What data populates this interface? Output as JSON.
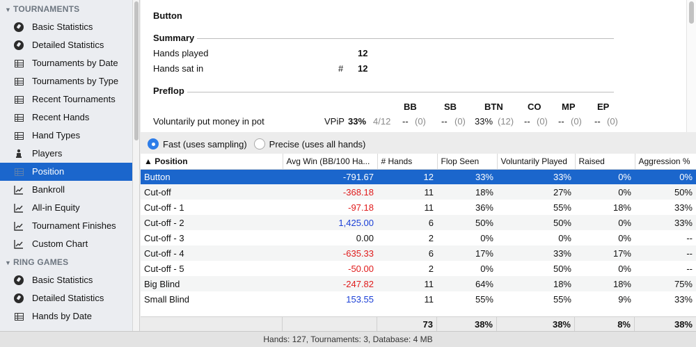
{
  "sidebar": {
    "sections": [
      {
        "title": "TOURNAMENTS",
        "items": [
          {
            "label": "Basic Statistics",
            "icon": "dashboard-icon"
          },
          {
            "label": "Detailed Statistics",
            "icon": "dashboard-icon"
          },
          {
            "label": "Tournaments by Date",
            "icon": "table-icon"
          },
          {
            "label": "Tournaments by Type",
            "icon": "table-icon"
          },
          {
            "label": "Recent Tournaments",
            "icon": "table-icon"
          },
          {
            "label": "Recent Hands",
            "icon": "table-icon"
          },
          {
            "label": "Hand Types",
            "icon": "table-icon"
          },
          {
            "label": "Players",
            "icon": "players-icon"
          },
          {
            "label": "Position",
            "icon": "table-icon",
            "selected": true
          },
          {
            "label": "Bankroll",
            "icon": "line-chart-icon"
          },
          {
            "label": "All-in Equity",
            "icon": "line-chart-icon"
          },
          {
            "label": "Tournament Finishes",
            "icon": "line-chart-icon"
          },
          {
            "label": "Custom Chart",
            "icon": "line-chart-icon"
          }
        ]
      },
      {
        "title": "RING GAMES",
        "items": [
          {
            "label": "Basic Statistics",
            "icon": "dashboard-icon"
          },
          {
            "label": "Detailed Statistics",
            "icon": "dashboard-icon"
          },
          {
            "label": "Hands by Date",
            "icon": "table-icon"
          }
        ]
      }
    ]
  },
  "detail": {
    "title": "Button",
    "summary": {
      "heading": "Summary",
      "hands_played_label": "Hands played",
      "hands_played_value": "12",
      "hands_sat_label": "Hands sat in",
      "hands_sat_symbol": "#",
      "hands_sat_value": "12"
    },
    "preflop": {
      "heading": "Preflop",
      "columns": [
        "BB",
        "SB",
        "BTN",
        "CO",
        "MP",
        "EP"
      ],
      "vpip_label": "Voluntarily put money in pot",
      "vpip_abbr": "VPiP",
      "vpip_value": "33%",
      "vpip_count": "4/12",
      "cells": [
        {
          "value": "--",
          "count": "(0)"
        },
        {
          "value": "--",
          "count": "(0)"
        },
        {
          "value": "33%",
          "count": "(12)"
        },
        {
          "value": "--",
          "count": "(0)"
        },
        {
          "value": "--",
          "count": "(0)"
        },
        {
          "value": "--",
          "count": "(0)"
        }
      ]
    }
  },
  "sampling": {
    "fast_label": "Fast (uses sampling)",
    "precise_label": "Precise (uses all hands)",
    "selected": "fast"
  },
  "table": {
    "headers": [
      "▲ Position",
      "Avg Win (BB/100 Ha...",
      "# Hands",
      "Flop Seen",
      "Voluntarily Played",
      "Raised",
      "Aggression %"
    ],
    "rows": [
      {
        "position": "Button",
        "avg_win": "-791.67",
        "sign": "neg",
        "hands": "12",
        "flop": "33%",
        "vol": "33%",
        "raised": "0%",
        "aggr": "0%"
      },
      {
        "position": "Cut-off",
        "avg_win": "-368.18",
        "sign": "neg",
        "hands": "11",
        "flop": "18%",
        "vol": "27%",
        "raised": "0%",
        "aggr": "50%"
      },
      {
        "position": "Cut-off - 1",
        "avg_win": "-97.18",
        "sign": "neg",
        "hands": "11",
        "flop": "36%",
        "vol": "55%",
        "raised": "18%",
        "aggr": "33%"
      },
      {
        "position": "Cut-off - 2",
        "avg_win": "1,425.00",
        "sign": "pos",
        "hands": "6",
        "flop": "50%",
        "vol": "50%",
        "raised": "0%",
        "aggr": "33%"
      },
      {
        "position": "Cut-off - 3",
        "avg_win": "0.00",
        "sign": "zero",
        "hands": "2",
        "flop": "0%",
        "vol": "0%",
        "raised": "0%",
        "aggr": "--"
      },
      {
        "position": "Cut-off - 4",
        "avg_win": "-635.33",
        "sign": "neg",
        "hands": "6",
        "flop": "17%",
        "vol": "33%",
        "raised": "17%",
        "aggr": "--"
      },
      {
        "position": "Cut-off - 5",
        "avg_win": "-50.00",
        "sign": "neg",
        "hands": "2",
        "flop": "0%",
        "vol": "50%",
        "raised": "0%",
        "aggr": "--"
      },
      {
        "position": "Big Blind",
        "avg_win": "-247.82",
        "sign": "neg",
        "hands": "11",
        "flop": "64%",
        "vol": "18%",
        "raised": "18%",
        "aggr": "75%"
      },
      {
        "position": "Small Blind",
        "avg_win": "153.55",
        "sign": "pos",
        "hands": "11",
        "flop": "55%",
        "vol": "55%",
        "raised": "9%",
        "aggr": "33%"
      }
    ],
    "totals": {
      "avg_win": "",
      "hands": "73",
      "flop": "38%",
      "vol": "38%",
      "raised": "8%",
      "aggr": "38%"
    },
    "selected_row": 0
  },
  "colors": {
    "accent": "#1b66cc",
    "negative": "#e01b1b",
    "positive": "#1a3fd6"
  },
  "status": "Hands: 127, Tournaments: 3, Database: 4 MB"
}
